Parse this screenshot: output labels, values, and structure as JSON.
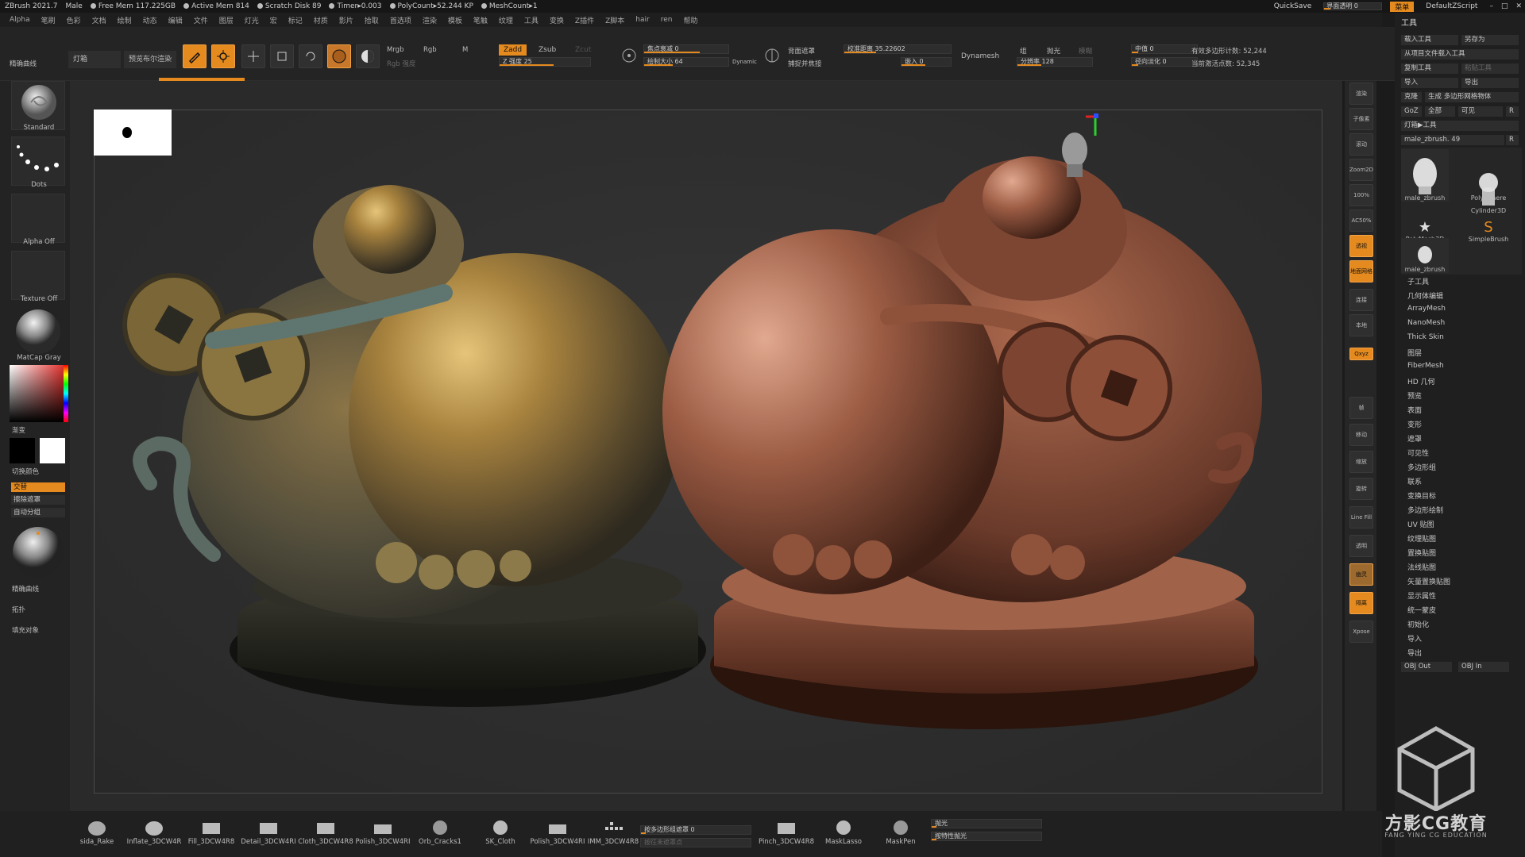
{
  "titlebar": {
    "app": "ZBrush 2021.7",
    "doc": "Male",
    "stats": [
      "Free Mem 117.225GB",
      "Active Mem 814",
      "Scratch Disk 89",
      "Timer▸0.003",
      "PolyCount▸52.244 KP",
      "MeshCount▸1"
    ],
    "quicksave": "QuickSave",
    "transparency": "界面透明 0",
    "menu_btn": "菜单",
    "script": "DefaultZScript"
  },
  "menu": [
    "Alpha",
    "笔刷",
    "色彩",
    "文档",
    "绘制",
    "动态",
    "编辑",
    "文件",
    "图层",
    "灯光",
    "宏",
    "标记",
    "材质",
    "影片",
    "拾取",
    "首选项",
    "渲染",
    "模板",
    "笔触",
    "纹理",
    "工具",
    "变换",
    "Z插件",
    "Z脚本",
    "hair",
    "ren",
    "帮助"
  ],
  "toolbar": {
    "lightbox": "灯箱",
    "bpr_preview": "预览布尔渲染",
    "edit": "Edit",
    "draw": "绘制",
    "move": "移动",
    "scale": "缩放",
    "rotate": "旋转",
    "mrgb": "Mrgb",
    "rgb": "Rgb",
    "m": "M",
    "rgb_intensity": "Rgb 强度",
    "zadd": "Zadd",
    "zsub": "Zsub",
    "zcut": "Zcut",
    "z_intensity": "Z 强度 25",
    "focal_shift": "焦点衰减 0",
    "draw_size": "绘制大小 64",
    "dynamic": "Dynamic",
    "backface_mask": "背面遮罩",
    "snap_merge": "捕捉并焦接",
    "calibration": "校准距离 35.22602",
    "embed": "嵌入 0",
    "dynamesh": "Dynamesh",
    "group": "组",
    "polish": "抛光",
    "blur": "模糊",
    "resolution": "分辨率 128",
    "median": "中值 0",
    "radial_fade": "径向淡化 0",
    "active_points": "有效多边形计数: 52,244",
    "total_points": "当前激活点数: 52,345"
  },
  "leftshelf": {
    "top_label": "精确曲线",
    "brush": "Standard",
    "stroke": "Dots",
    "alpha": "Alpha Off",
    "texture": "Texture Off",
    "material": "MatCap Gray",
    "gradient": "渐变",
    "switch_color": "切换颜色",
    "alternate": "交替",
    "clear_mask": "擦除遮罩",
    "auto_group": "自动分组",
    "curve": "精确曲线",
    "topology": "拓扑",
    "fill_object": "填充对象"
  },
  "rightpanel": {
    "title": "工具",
    "load_tool": "载入工具",
    "save_as": "另存为",
    "load_from_project": "从项目文件载入工具",
    "copy_tool": "复制工具",
    "paste_tool": "粘贴工具",
    "import": "导入",
    "export": "导出",
    "clone": "克隆",
    "make_polymesh": "生成 多边形网格物体",
    "goz": "GoZ",
    "all": "全部",
    "visible": "可见",
    "r": "R",
    "lightbox_tools": "灯箱▶工具",
    "current_tool": "male_zbrush. 49",
    "thumbs": [
      "male_zbrush",
      "PolySphere",
      "Cylinder3D",
      "PolyMesh3D",
      "SimpleBrush",
      "male_zbrush"
    ],
    "items": [
      "子工具",
      "几何体编辑",
      "ArrayMesh",
      "NanoMesh",
      "Thick Skin",
      "图层",
      "FiberMesh",
      "HD 几何",
      "预览",
      "表面",
      "变形",
      "遮罩",
      "可见性",
      "多边形组",
      "联系",
      "变换目标",
      "多边形绘制",
      "UV 贴图",
      "纹理贴图",
      "置换贴图",
      "法线贴图",
      "矢量置换贴图",
      "显示属性",
      "统一蒙皮",
      "初始化",
      "导入",
      "导出"
    ],
    "obj_out": "OBJ Out",
    "obj_in": "OBJ In"
  },
  "rightcolumn": [
    "渲染",
    "子像素",
    "滚动",
    "Zoom2D",
    "100%",
    "AC50%",
    "透视",
    "地面网格",
    "连接",
    "本地",
    "Qxyz",
    "帧",
    "移动",
    "缩放",
    "旋转",
    "Line Fill",
    "透明",
    "幽灵",
    "隔离",
    "Xpose"
  ],
  "bottomshelf": {
    "brushes": [
      "sida_Rake",
      "Inflate_3DCW4R",
      "Fill_3DCW4R8",
      "Detail_3DCW4RI",
      "Cloth_3DCW4R8",
      "Polish_3DCW4RI",
      "Orb_Cracks1",
      "SK_Cloth",
      "Polish_3DCW4RI",
      "IMM_3DCW4R8",
      "Pinch_3DCW4R8",
      "MaskLasso",
      "MaskPen"
    ],
    "polygroup_mask": "按多边形组遮罩 0",
    "unmask": "按彺未遮罩点",
    "polish": "抛光",
    "polish_by_features": "按特性抛光"
  },
  "watermark": {
    "title": "方影CG教育",
    "subtitle": "FANG YING CG EDUCATION"
  },
  "colors": {
    "accent": "#e58a1f",
    "bg": "#2a2a2a",
    "bronze": "#8a6d3b",
    "clay": "#7a4a36"
  }
}
